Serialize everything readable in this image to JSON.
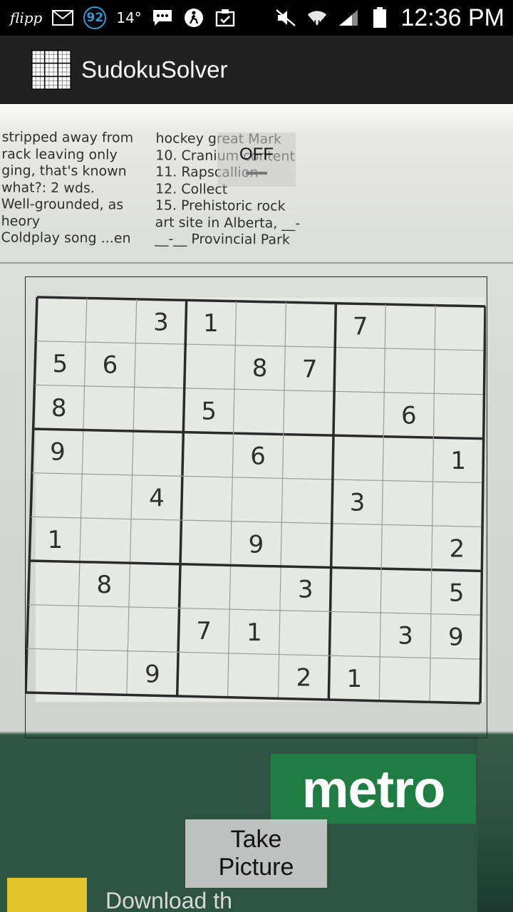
{
  "status_bar": {
    "flipp": "flipp",
    "badge": "92",
    "temperature": "14°",
    "time": "12:36 PM"
  },
  "app": {
    "title": "SudokuSolver"
  },
  "newspaper": {
    "left_column": "stripped away from\nrack leaving only\nging, that's known\nwhat?: 2 wds.\nWell-grounded, as\nheory\nColdplay song ...en",
    "right_column": "hockey great Mark\n10. Cranium content\n11. Rapscallion\n12. Collect\n15. Prehistoric rock\nart site in Alberta, __-\n__-__ Provincial Park",
    "logo": "metro",
    "bottom": "Download th"
  },
  "toggle": {
    "label": "OFF"
  },
  "sudoku": {
    "grid": [
      [
        "",
        "",
        "3",
        "1",
        "",
        "",
        "7",
        "",
        ""
      ],
      [
        "5",
        "6",
        "",
        "",
        "8",
        "7",
        "",
        "",
        ""
      ],
      [
        "8",
        "",
        "",
        "5",
        "",
        "",
        "",
        "6",
        ""
      ],
      [
        "9",
        "",
        "",
        "",
        "6",
        "",
        "",
        "",
        "1"
      ],
      [
        "",
        "",
        "4",
        "",
        "",
        "",
        "3",
        "",
        ""
      ],
      [
        "1",
        "",
        "",
        "",
        "9",
        "",
        "",
        "",
        "2"
      ],
      [
        "",
        "8",
        "",
        "",
        "",
        "3",
        "",
        "",
        "5"
      ],
      [
        "",
        "",
        "",
        "7",
        "1",
        "",
        "",
        "3",
        "9"
      ],
      [
        "",
        "",
        "9",
        "",
        "",
        "2",
        "1",
        "",
        ""
      ]
    ]
  },
  "take_picture": {
    "label": "Take Picture"
  }
}
